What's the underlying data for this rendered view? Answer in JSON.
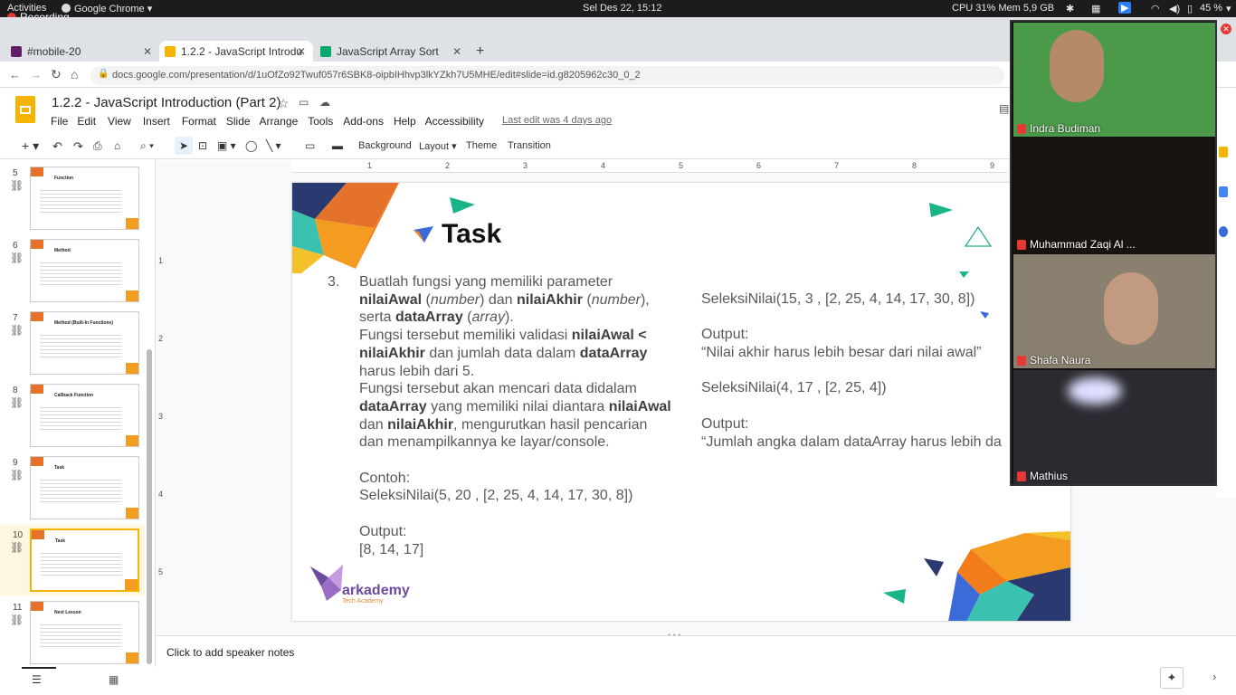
{
  "system": {
    "activities": "Activities",
    "app": "Google Chrome",
    "recording": "Recording",
    "datetime": "Sel Des 22, 15:12",
    "stats": "CPU 31% Mem 5,9 GB",
    "battery": "45 %"
  },
  "browser": {
    "tabs": [
      {
        "label": "#mobile-20"
      },
      {
        "label": "1.2.2 - JavaScript Introdu"
      },
      {
        "label": "JavaScript Array Sort"
      }
    ],
    "url": "docs.google.com/presentation/d/1uOfZo92Twuf057r6SBK8-oipbIHhvp3lkYZkh7U5MHE/edit#slide=id.g8205962c30_0_2"
  },
  "doc": {
    "title": "1.2.2 - JavaScript Introduction (Part 2)",
    "menu": [
      "File",
      "Edit",
      "View",
      "Insert",
      "Format",
      "Slide",
      "Arrange",
      "Tools",
      "Add-ons",
      "Help",
      "Accessibility"
    ],
    "last_edit": "Last edit was 4 days ago"
  },
  "toolbar": {
    "background": "Background",
    "layout": "Layout",
    "theme": "Theme",
    "transition": "Transition"
  },
  "ruler": [
    "1",
    "2",
    "3",
    "4",
    "5",
    "6",
    "7",
    "8",
    "9"
  ],
  "vruler": [
    "1",
    "2",
    "3",
    "4",
    "5"
  ],
  "thumbnails": [
    {
      "num": "5",
      "title": "Function"
    },
    {
      "num": "6",
      "title": "Method"
    },
    {
      "num": "7",
      "title": "Method (Built-In Functions)"
    },
    {
      "num": "8",
      "title": "Callback Function"
    },
    {
      "num": "9",
      "title": "Task"
    },
    {
      "num": "10",
      "title": "Task"
    },
    {
      "num": "11",
      "title": "Next Lesson"
    }
  ],
  "slide": {
    "heading": "Task",
    "num": "3.",
    "left": {
      "l1": "Buatlah fungsi yang memiliki parameter",
      "l2a": "nilaiAwal",
      "l2b": " (",
      "l2c": "number",
      "l2d": ") dan ",
      "l2e": "nilaiAkhir",
      "l2f": " (",
      "l2g": "number",
      "l2h": "),",
      "l3a": "serta ",
      "l3b": "dataArray",
      "l3c": " (",
      "l3d": "array",
      "l3e": ").",
      "l4a": "Fungsi tersebut memiliki validasi ",
      "l4b": "nilaiAwal <",
      "l5a": "nilaiAkhir",
      "l5b": " dan jumlah data dalam ",
      "l5c": "dataArray",
      "l6": "harus lebih dari 5.",
      "l7": "Fungsi tersebut akan mencari data didalam",
      "l8a": "dataArray",
      "l8b": " yang memiliki nilai diantara ",
      "l8c": "nilaiAwal",
      "l9a": "dan ",
      "l9b": "nilaiAkhir",
      "l9c": ", mengurutkan hasil pencarian",
      "l10": "dan menampilkannya ke layar/console.",
      "contoh": "Contoh:",
      "example": "SeleksiNilai(5, 20 , [2, 25, 4, 14, 17, 30, 8])",
      "output_label": "Output:",
      "output": "[8, 14, 17]"
    },
    "right": {
      "ex1": "SeleksiNilai(15, 3 , [2, 25, 4, 14, 17, 30, 8])",
      "out1_label": "Output:",
      "out1": "“Nilai akhir harus lebih besar dari nilai awal”",
      "ex2": "SeleksiNilai(4, 17 , [2, 25, 4])",
      "out2_label": "Output:",
      "out2": "“Jumlah angka dalam dataArray harus lebih da"
    },
    "logo": "arkademy",
    "logo_sub": "Tech Academy"
  },
  "notes": "Click to add speaker notes",
  "participants": [
    {
      "name": "Indra Budiman",
      "bg": "#4a9a4a"
    },
    {
      "name": "Muhammad Zaqi Al ...",
      "bg": "#1a1410"
    },
    {
      "name": "Shafa Naura",
      "bg": "#8a8070"
    },
    {
      "name": "Mathius",
      "bg": "#2a2a30"
    }
  ],
  "colors": {
    "slides_yellow": "#f4b400",
    "accent_orange": "#f57c00",
    "green_accent": "#0f9d58",
    "dark_navy": "#1a2b6b"
  }
}
